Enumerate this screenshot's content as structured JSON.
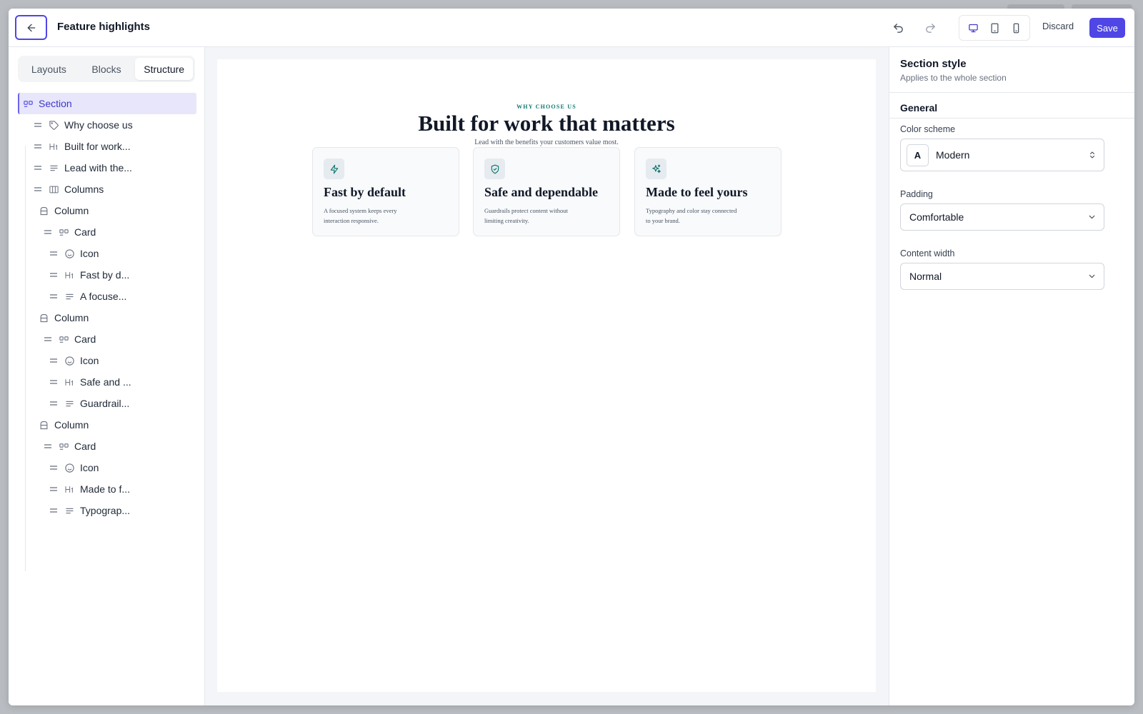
{
  "header": {
    "title": "Feature highlights",
    "discard_label": "Discard",
    "save_label": "Save"
  },
  "left_panel": {
    "tabs": [
      {
        "label": "Layouts",
        "active": false
      },
      {
        "label": "Blocks",
        "active": false
      },
      {
        "label": "Structure",
        "active": true
      }
    ],
    "tree": [
      {
        "label": "Section",
        "icon": "section-icon",
        "selected": true
      },
      {
        "label": "Why choose us",
        "icon": "tag-icon"
      },
      {
        "label": "Built for work...",
        "icon": "heading-icon"
      },
      {
        "label": "Lead with the...",
        "icon": "text-icon"
      },
      {
        "label": "Columns",
        "icon": "columns-icon"
      },
      {
        "label": "Column",
        "icon": "column-icon"
      },
      {
        "label": "Card",
        "icon": "card-icon"
      },
      {
        "label": "Icon",
        "icon": "smiley-icon"
      },
      {
        "label": "Fast by d...",
        "icon": "heading-icon"
      },
      {
        "label": "A focuse...",
        "icon": "text-icon"
      },
      {
        "label": "Column",
        "icon": "column-icon"
      },
      {
        "label": "Card",
        "icon": "card-icon"
      },
      {
        "label": "Icon",
        "icon": "smiley-icon"
      },
      {
        "label": "Safe and ...",
        "icon": "heading-icon"
      },
      {
        "label": "Guardrail...",
        "icon": "text-icon"
      },
      {
        "label": "Column",
        "icon": "column-icon"
      },
      {
        "label": "Card",
        "icon": "card-icon"
      },
      {
        "label": "Icon",
        "icon": "smiley-icon"
      },
      {
        "label": "Made to f...",
        "icon": "heading-icon"
      },
      {
        "label": "Typograp...",
        "icon": "text-icon"
      }
    ]
  },
  "canvas": {
    "eyebrow": "WHY CHOOSE US",
    "headline": "Built for work that matters",
    "lead": "Lead with the benefits your customers value most.",
    "cards": [
      {
        "icon": "lightning-icon",
        "title": "Fast by default",
        "text": "A focused system keeps every interaction responsive."
      },
      {
        "icon": "shield-check-icon",
        "title": "Safe and dependable",
        "text": "Guardrails protect content without limiting creativity."
      },
      {
        "icon": "sparkles-icon",
        "title": "Made to feel yours",
        "text": "Typography and color stay connected to your brand."
      }
    ]
  },
  "right_panel": {
    "title": "Section style",
    "subtitle": "Applies to the whole section",
    "group": "General",
    "color_scheme": {
      "label": "Color scheme",
      "badge": "A",
      "value": "Modern"
    },
    "padding": {
      "label": "Padding",
      "value": "Comfortable"
    },
    "content_width": {
      "label": "Content width",
      "value": "Normal"
    }
  },
  "colors": {
    "accent": "#4f46e5",
    "eyebrow": "#0f766e",
    "selected_row": "#e7e6fb"
  }
}
